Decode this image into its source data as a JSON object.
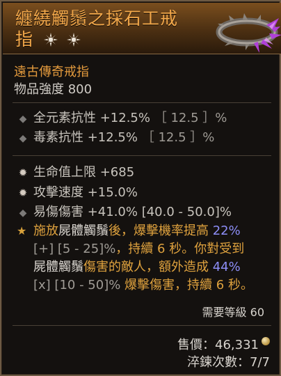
{
  "item": {
    "name_line1": "纏繞觸鬚之採石工戒",
    "name_line2": "指",
    "type": "遠古傳奇戒指",
    "power": "物品強度 800"
  },
  "stats": [
    {
      "label": "全元素抗性 +12.5%",
      "range": "［ 12.5 ］%"
    },
    {
      "label": "毒素抗性 +12.5%",
      "range": "［ 12.5 ］%"
    }
  ],
  "affixes": [
    {
      "text": "生命值上限 +685"
    },
    {
      "text": "攻擊速度 +15.0%"
    },
    {
      "text": "易傷傷害 +41.0% [40.0 - 50.0]%"
    }
  ],
  "aspect": {
    "l1_a": "施放",
    "l1_b": "屍體觸鬚",
    "l1_c": "後，爆擊機率提高",
    "l1_d": " 22%",
    "l2_a": "[+] [5 - 25]%",
    "l2_b": "，持續 6 秒。你對受到",
    "l3_a": "屍體觸鬚",
    "l3_b": "傷害的敵人，額外造成",
    "l3_c": " 44%",
    "l4_a": "[x] [10 - 50]%",
    "l4_b": " 爆擊傷害，持續 6 秒。"
  },
  "requirement": "需要等級 60",
  "sell": "售價：46,331",
  "temper": "淬鍊次數：7/7",
  "colors": {
    "title": "#f3a84a",
    "legendary": "#e39a3d",
    "magic_blue": "#8d8ef7"
  }
}
